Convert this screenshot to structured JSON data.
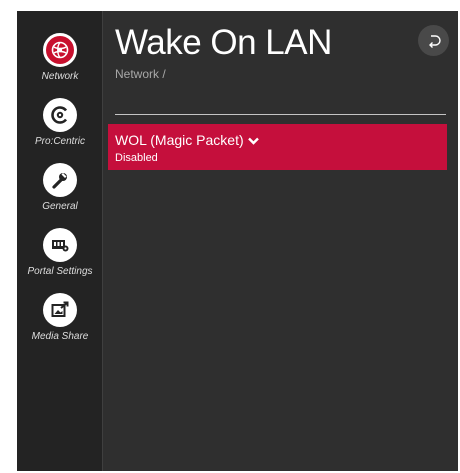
{
  "page": {
    "title": "Wake On LAN",
    "breadcrumb": "Network /"
  },
  "sidebar": {
    "items": [
      {
        "label": "Network",
        "icon": "network-icon",
        "active": true
      },
      {
        "label": "Pro:Centric",
        "icon": "procentric-icon",
        "active": false
      },
      {
        "label": "General",
        "icon": "wrench-icon",
        "active": false
      },
      {
        "label": "Portal Settings",
        "icon": "portal-settings-icon",
        "active": false
      },
      {
        "label": "Media Share",
        "icon": "media-share-icon",
        "active": false
      }
    ]
  },
  "back_button": {
    "icon": "back-arrow-icon"
  },
  "setting": {
    "label": "WOL (Magic Packet)",
    "value": "Disabled",
    "icon": "chevron-down-icon"
  },
  "colors": {
    "accent": "#c50f3c",
    "active_icon": "#c8102e",
    "panel_bg": "#2f2f2f",
    "sidebar_bg": "#232323"
  }
}
